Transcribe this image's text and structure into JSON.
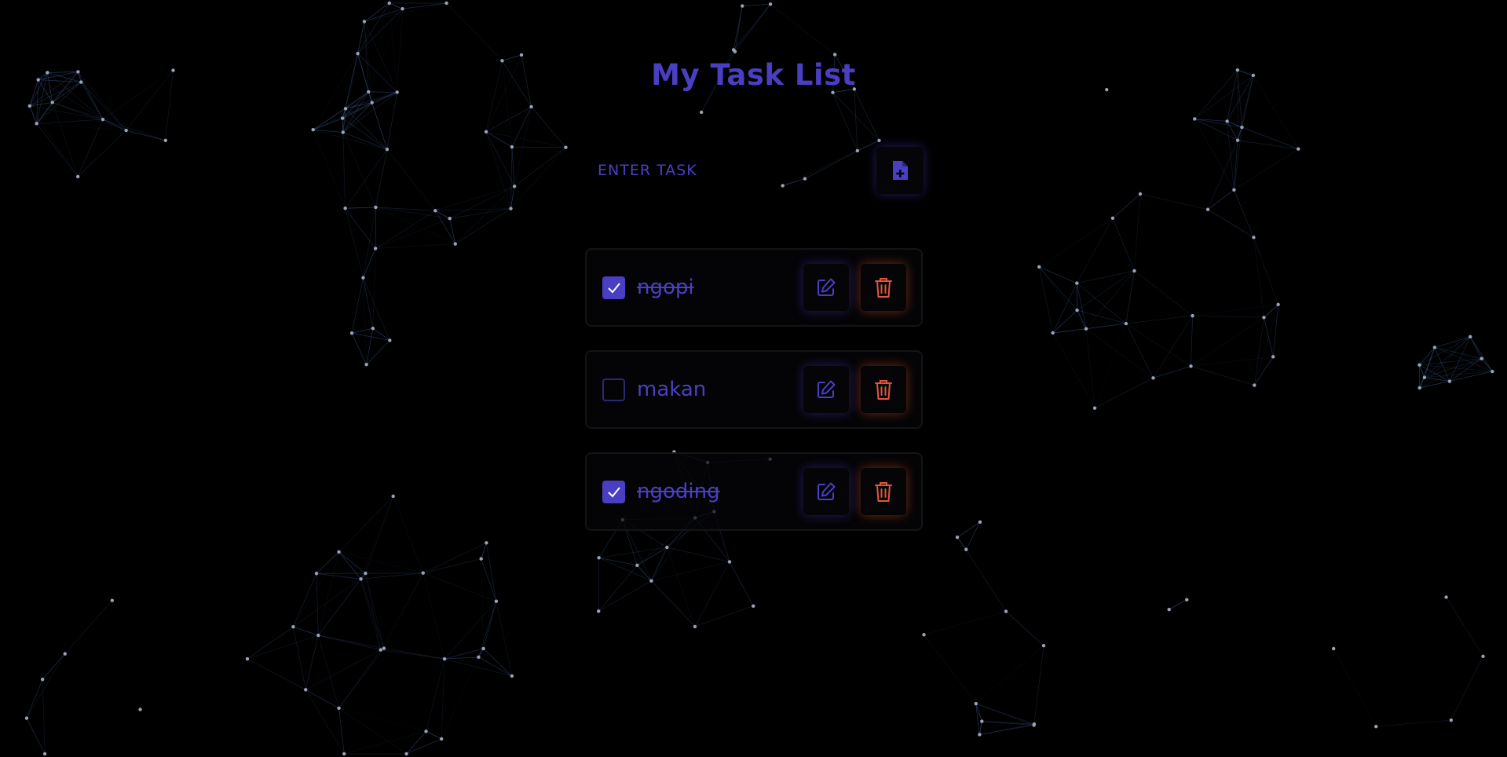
{
  "app": {
    "title": "My Task List"
  },
  "input": {
    "placeholder": "ENTER TASK",
    "value": ""
  },
  "icons": {
    "add": "file-plus-icon",
    "check": "check-icon",
    "edit": "pencil-square-icon",
    "delete": "trash-icon"
  },
  "tasks": [
    {
      "label": "ngopi",
      "done": true
    },
    {
      "label": "makan",
      "done": false
    },
    {
      "label": "ngoding",
      "done": true
    }
  ],
  "colors": {
    "background": "#000000",
    "accent": "#4a3fc2",
    "delete": "#e5553a",
    "network_line": "#3b5a8a",
    "network_node": "#9aa3b5"
  }
}
